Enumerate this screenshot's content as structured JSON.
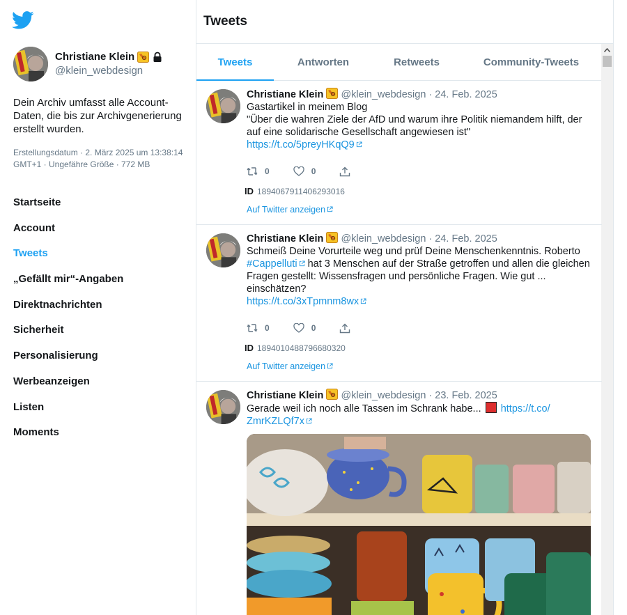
{
  "profile": {
    "name": "Christiane Klein",
    "handle": "@klein_webdesign"
  },
  "archive": {
    "description": "Dein Archiv umfasst alle Account-Daten, die bis zur Archivgenerierung erstellt wurden.",
    "meta": "Erstellungsdatum · 2. März 2025 um 13:38:14 GMT+1 · Ungefähre Größe · 772 MB"
  },
  "nav": {
    "items": [
      {
        "label": "Startseite"
      },
      {
        "label": "Account"
      },
      {
        "label": "Tweets"
      },
      {
        "label": "„Gefällt mir“-Angaben"
      },
      {
        "label": "Direktnachrichten"
      },
      {
        "label": "Sicherheit"
      },
      {
        "label": "Personalisierung"
      },
      {
        "label": "Werbeanzeigen"
      },
      {
        "label": "Listen"
      },
      {
        "label": "Moments"
      }
    ],
    "active": "Tweets"
  },
  "main": {
    "title": "Tweets",
    "tabs": [
      {
        "label": "Tweets"
      },
      {
        "label": "Antworten"
      },
      {
        "label": "Retweets"
      },
      {
        "label": "Community-Tweets"
      }
    ]
  },
  "tweets": [
    {
      "name": "Christiane Klein",
      "handle": "@klein_webdesign",
      "date": "24. Feb. 2025",
      "text1": "Gastartikel in meinem Blog",
      "text2": "\"Über die wahren Ziele der AfD und warum ihre Politik niemandem hilft, der auf eine solidarische Gesellschaft angewiesen ist\"",
      "link": "https://t.co/5preyHKqQ9",
      "retweets": "0",
      "likes": "0",
      "id_label": "ID",
      "id": "1894067911406293016",
      "view_link": "Auf Twitter anzeigen"
    },
    {
      "name": "Christiane Klein",
      "handle": "@klein_webdesign",
      "date": "24. Feb. 2025",
      "text1": "Schmeiß Deine Vorurteile weg und prüf Deine Menschenkenntnis. Roberto",
      "hashtag": "#Cappelluti",
      "text2": "hat 3 Menschen auf der Straße getroffen und allen die gleichen Fragen gestellt: Wissensfragen und persönliche Fragen. Wie gut ... einschätzen?",
      "link": "https://t.co/3xTpmnm8wx",
      "retweets": "0",
      "likes": "0",
      "id_label": "ID",
      "id": "1894010488796680320",
      "view_link": "Auf Twitter anzeigen"
    },
    {
      "name": "Christiane Klein",
      "handle": "@klein_webdesign",
      "date": "23. Feb. 2025",
      "text1": "Gerade weil ich noch alle Tassen im Schrank habe...",
      "link1": "https://t.co/",
      "link2": "ZmrKZLQf7x"
    }
  ],
  "colors": {
    "accent": "#1da1f2",
    "link": "#1b95e0",
    "muted": "#657786",
    "text": "#14171a",
    "border": "#e1e8ed"
  }
}
